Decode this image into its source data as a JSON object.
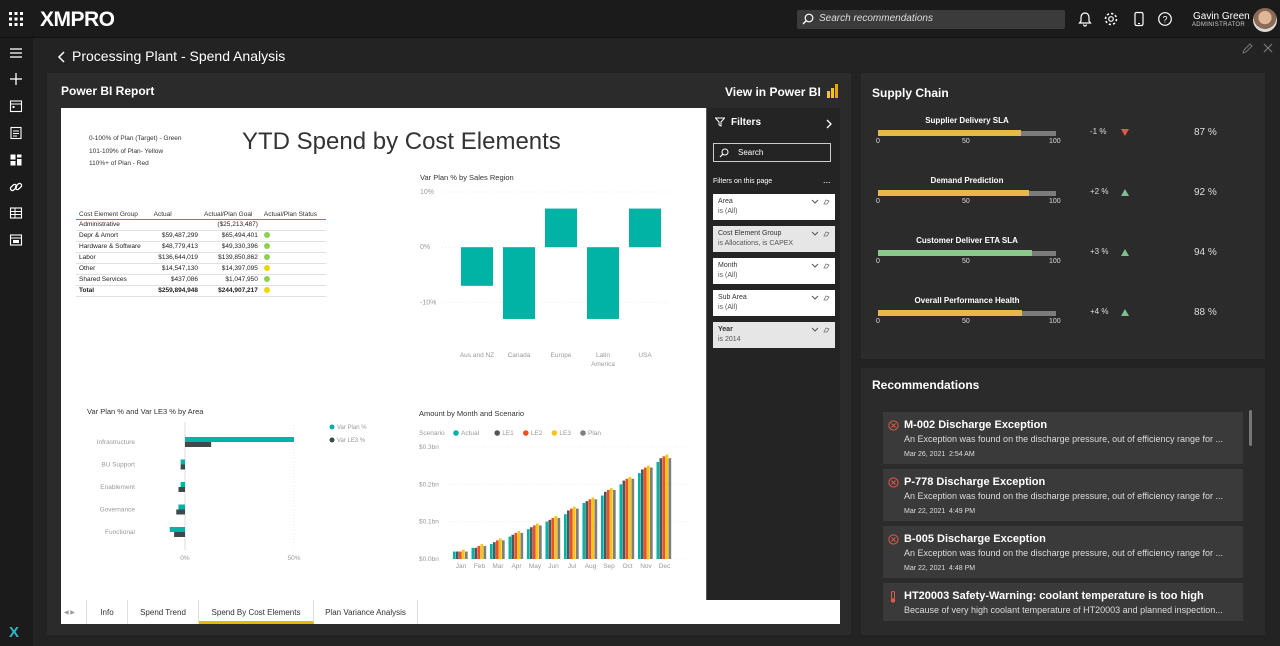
{
  "topbar": {
    "logo": "XMPRO",
    "search_placeholder": "Search recommendations",
    "user_name": "Gavin Green",
    "user_role": "ADMINISTRATOR"
  },
  "page": {
    "title": "Processing Plant - Spend Analysis"
  },
  "pbi": {
    "panel_title": "Power BI Report",
    "view_link": "View in Power BI",
    "report_title": "YTD Spend by Cost Elements",
    "legend_text": [
      "0-100% of Plan (Target) - Green",
      "101-109% of Plan- Yellow",
      "110%+ of Plan - Red"
    ],
    "table": {
      "headers": [
        "Cost Element Group",
        "Actual",
        "Actual/Plan Goal",
        "Actual/Plan Status"
      ],
      "rows": [
        {
          "group": "Administrative",
          "actual": "",
          "goal": "($25,213,487)",
          "status": ""
        },
        {
          "group": "Depr & Amort",
          "actual": "$59,487,299",
          "goal": "$65,494,401",
          "status": "green"
        },
        {
          "group": "Hardware & Software",
          "actual": "$48,779,413",
          "goal": "$49,330,396",
          "status": "green"
        },
        {
          "group": "Labor",
          "actual": "$136,644,019",
          "goal": "$139,850,862",
          "status": "green"
        },
        {
          "group": "Other",
          "actual": "$14,547,130",
          "goal": "$14,397,095",
          "status": "yellow"
        },
        {
          "group": "Shared Services",
          "actual": "$437,086",
          "goal": "$1,047,950",
          "status": "green"
        },
        {
          "group": "Total",
          "actual": "$259,894,948",
          "goal": "$244,907,217",
          "status": "yellow"
        }
      ]
    },
    "tabs": [
      "Info",
      "Spend Trend",
      "Spend By Cost Elements",
      "Plan Variance Analysis"
    ],
    "active_tab": "Spend By Cost Elements"
  },
  "filters": {
    "title": "Filters",
    "search": "Search",
    "section": "Filters on this page",
    "more": "...",
    "cards": [
      {
        "name": "Area",
        "value": "is (All)",
        "selected": false,
        "bold": false
      },
      {
        "name": "Cost Element Group",
        "value": "is Allocations, is CAPEX",
        "selected": true,
        "bold": false
      },
      {
        "name": "Month",
        "value": "is (All)",
        "selected": false,
        "bold": false
      },
      {
        "name": "Sub Area",
        "value": "is (All)",
        "selected": false,
        "bold": false
      },
      {
        "name": "Year",
        "value": "is 2014",
        "selected": true,
        "bold": true
      }
    ]
  },
  "chart_data": [
    {
      "type": "bar",
      "title": "Var Plan % by Sales Region",
      "categories": [
        "Aus and NZ",
        "Canada",
        "Europe",
        "Latin America",
        "USA"
      ],
      "values": [
        -7,
        -13,
        7,
        -13,
        7
      ],
      "ylim": [
        -15,
        10
      ],
      "yticks": [
        "10%",
        "0%",
        "-10%"
      ],
      "color": "#00b3a4"
    },
    {
      "type": "bar",
      "title": "Var Plan % and Var LE3 % by Area",
      "orientation": "horizontal",
      "categories": [
        "Infrastructure",
        "BU Support",
        "Enablement",
        "Governance",
        "Functional"
      ],
      "series": [
        {
          "name": "Var Plan %",
          "values": [
            50,
            -2,
            -2,
            -3,
            -7
          ],
          "color": "#00b3a4"
        },
        {
          "name": "Var LE3 %",
          "values": [
            12,
            -2,
            -3,
            -4,
            -5
          ],
          "color": "#3c4a4a"
        }
      ],
      "xticks": [
        "0%",
        "50%"
      ]
    },
    {
      "type": "bar",
      "title": "Amount by Month and Scenario",
      "legend_title": "Scenario",
      "categories": [
        "Jan",
        "Feb",
        "Mar",
        "Apr",
        "May",
        "Jun",
        "Jul",
        "Aug",
        "Sep",
        "Oct",
        "Nov",
        "Dec"
      ],
      "yticks": [
        "$0.3bn",
        "$0.2bn",
        "$0.1bn",
        "$0.0bn"
      ],
      "ylim": [
        0,
        0.3
      ],
      "series": [
        {
          "name": "Actual",
          "color": "#00b3a4",
          "values": [
            0.02,
            0.03,
            0.04,
            0.06,
            0.08,
            0.1,
            0.12,
            0.15,
            0.17,
            0.2,
            0.23,
            0.26
          ]
        },
        {
          "name": "LE1",
          "color": "#555555",
          "values": [
            0.02,
            0.03,
            0.045,
            0.065,
            0.085,
            0.105,
            0.13,
            0.155,
            0.18,
            0.21,
            0.24,
            0.27
          ]
        },
        {
          "name": "LE2",
          "color": "#f25022",
          "values": [
            0.02,
            0.035,
            0.05,
            0.07,
            0.09,
            0.11,
            0.135,
            0.16,
            0.185,
            0.215,
            0.245,
            0.275
          ]
        },
        {
          "name": "LE3",
          "color": "#f2c811",
          "values": [
            0.025,
            0.04,
            0.055,
            0.075,
            0.095,
            0.115,
            0.14,
            0.165,
            0.19,
            0.22,
            0.25,
            0.28
          ]
        },
        {
          "name": "Plan",
          "color": "#7f7f7f",
          "values": [
            0.02,
            0.035,
            0.05,
            0.07,
            0.09,
            0.11,
            0.135,
            0.16,
            0.185,
            0.215,
            0.245,
            0.27
          ]
        }
      ]
    }
  ],
  "supply_chain": {
    "title": "Supply Chain",
    "ticks": [
      "0",
      "50",
      "100"
    ],
    "rows": [
      {
        "label": "Supplier Delivery SLA",
        "value": 87,
        "target": 100,
        "change": "-1 %",
        "trend": "down",
        "pct": "87 %",
        "color": "#e8b84b"
      },
      {
        "label": "Demand Prediction",
        "value": 92,
        "target": 100,
        "change": "+2 %",
        "trend": "up",
        "pct": "92 %",
        "color": "#e8b84b"
      },
      {
        "label": "Customer Deliver ETA SLA",
        "value": 94,
        "target": 100,
        "change": "+3 %",
        "trend": "up",
        "pct": "94 %",
        "color": "#8bc98b"
      },
      {
        "label": "Overall Performance Health",
        "value": 88,
        "target": 100,
        "change": "+4 %",
        "trend": "up",
        "pct": "88 %",
        "color": "#e8b84b"
      }
    ]
  },
  "recommendations": {
    "title": "Recommendations",
    "items": [
      {
        "title": "M-002 Discharge Exception",
        "desc": "An Exception was found on the discharge pressure, out of efficiency range for ...",
        "date": "Mar 26, 2021",
        "time": "2:54 AM",
        "icon": "error-circle-icon"
      },
      {
        "title": "P-778 Discharge Exception",
        "desc": "An Exception was found on the discharge pressure, out of efficiency range for ...",
        "date": "Mar 22, 2021",
        "time": "4:49 PM",
        "icon": "error-circle-icon"
      },
      {
        "title": "B-005 Discharge Exception",
        "desc": "An Exception was found on the discharge pressure, out of efficiency range for ...",
        "date": "Mar 22, 2021",
        "time": "4:48 PM",
        "icon": "error-circle-icon"
      },
      {
        "title": "HT20003 Safety-Warning: coolant temperature is too high",
        "desc": "Because of very high coolant temperature of HT20003 and planned inspection...",
        "date": "",
        "time": "",
        "icon": "thermometer-icon"
      }
    ]
  }
}
